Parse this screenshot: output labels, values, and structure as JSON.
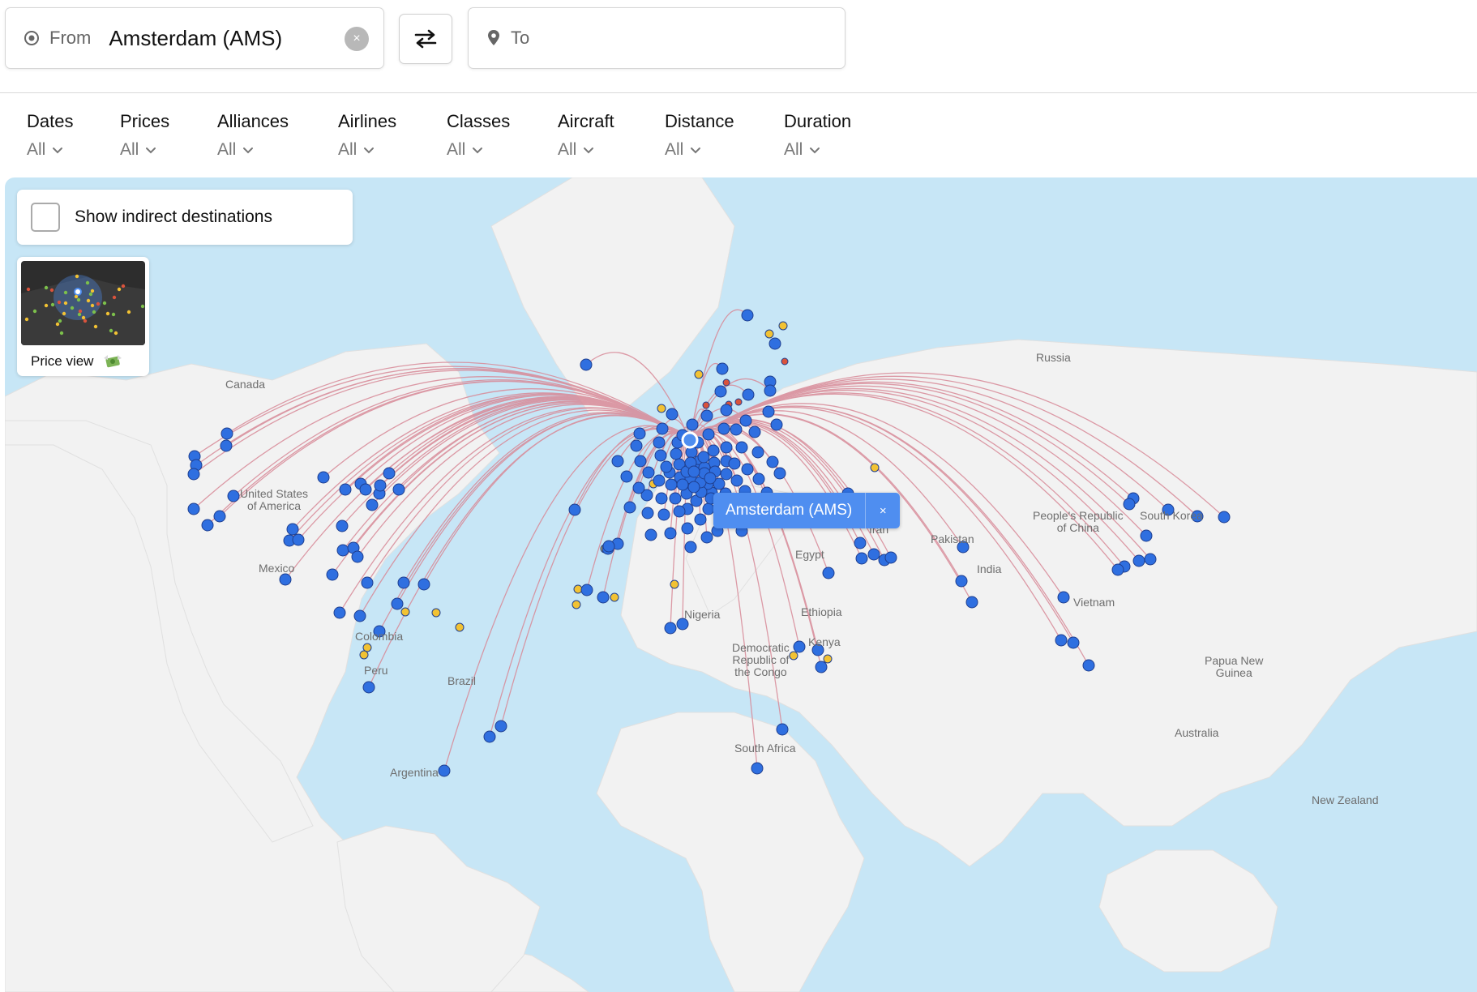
{
  "search": {
    "from_label": "From",
    "from_value": "Amsterdam (AMS)",
    "clear_symbol": "×",
    "to_placeholder": "To"
  },
  "filters": [
    {
      "title": "Dates",
      "value": "All"
    },
    {
      "title": "Prices",
      "value": "All"
    },
    {
      "title": "Alliances",
      "value": "All"
    },
    {
      "title": "Airlines",
      "value": "All"
    },
    {
      "title": "Classes",
      "value": "All"
    },
    {
      "title": "Aircraft",
      "value": "All"
    },
    {
      "title": "Distance",
      "value": "All"
    },
    {
      "title": "Duration",
      "value": "All"
    }
  ],
  "map": {
    "indirect_label": "Show indirect destinations",
    "indirect_checked": false,
    "price_view_label": "Price view",
    "price_view_icon": "money-wings-emoji",
    "origin_tooltip": "Amsterdam (AMS)",
    "tooltip_close": "×",
    "labels": [
      "Canada",
      "United States\nof America",
      "Mexico",
      "Colombia",
      "Peru",
      "Brazil",
      "Argentina",
      "Russia",
      "People's Republic\nof China",
      "South Korea",
      "Iran",
      "Pakistan",
      "India",
      "Vietnam",
      "Egypt",
      "Ethiopia",
      "Nigeria",
      "Kenya",
      "Democratic\nRepublic of\nthe Congo",
      "South Africa",
      "Papua New\nGuinea",
      "Australia",
      "New Zealand"
    ],
    "colors": {
      "route": "#d88a98",
      "direct": "#2f6fe0",
      "mid": "#f2c233",
      "high": "#d9533c",
      "water": "#c7e6f6",
      "land": "#f2f2f2"
    }
  }
}
